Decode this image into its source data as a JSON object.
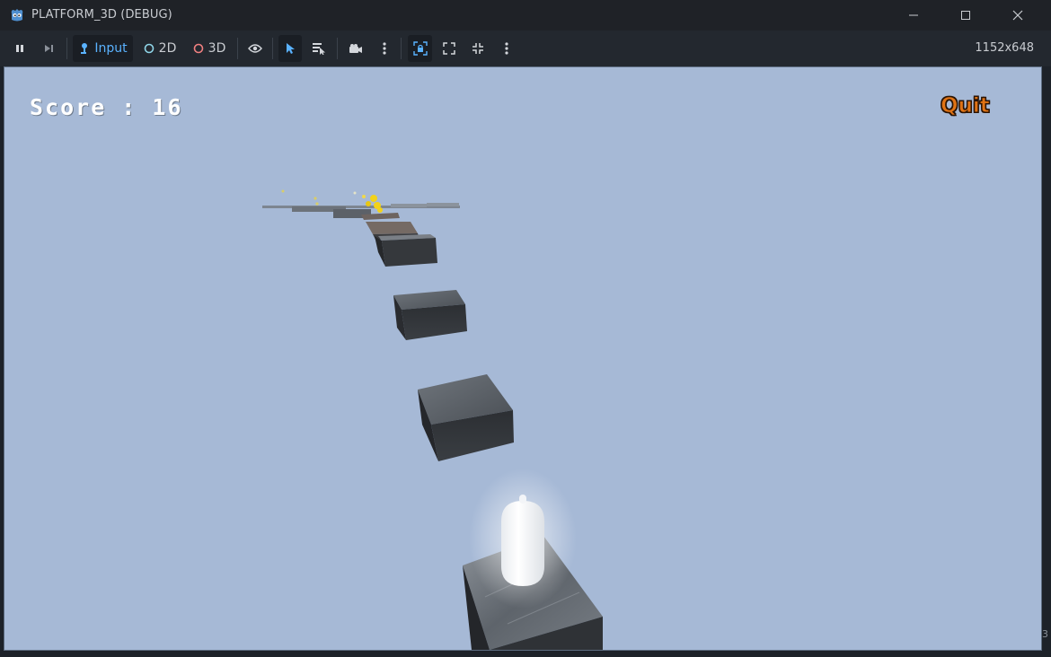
{
  "window": {
    "title": "PLATFORM_3D (DEBUG)"
  },
  "toolbar": {
    "input_label": "Input",
    "mode_2d_label": "2D",
    "mode_3d_label": "3D",
    "resolution": "1152x648"
  },
  "game": {
    "score_text": "Score : 16",
    "quit_label": "Quit"
  },
  "edge_glyph": "3",
  "colors": {
    "sky": "#a6b9d6",
    "accent_blue": "#5ab2ff",
    "quit_orange": "#e07315",
    "coin_yellow": "#f2d21a"
  }
}
